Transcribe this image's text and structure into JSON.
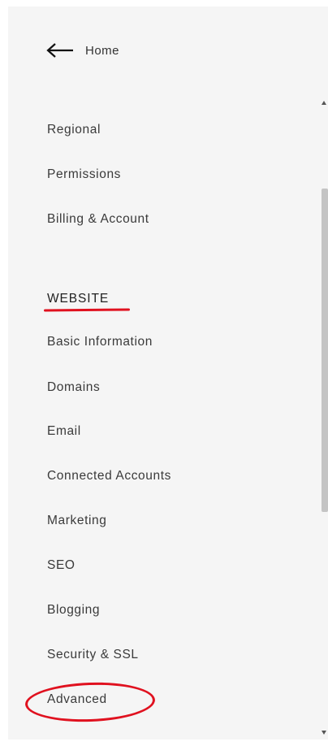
{
  "navigation": {
    "home_label": "Home",
    "back_icon": "arrow-left-icon"
  },
  "settings_items": [
    {
      "label": "Regional"
    },
    {
      "label": "Permissions"
    },
    {
      "label": "Billing & Account"
    }
  ],
  "website_section": {
    "heading": "WEBSITE",
    "items": [
      {
        "label": "Basic Information"
      },
      {
        "label": "Domains"
      },
      {
        "label": "Email"
      },
      {
        "label": "Connected Accounts"
      },
      {
        "label": "Marketing"
      },
      {
        "label": "SEO"
      },
      {
        "label": "Blogging"
      },
      {
        "label": "Security & SSL"
      },
      {
        "label": "Advanced"
      }
    ]
  },
  "annotation_color": "#e0111f",
  "panel_background": "#f5f5f5"
}
